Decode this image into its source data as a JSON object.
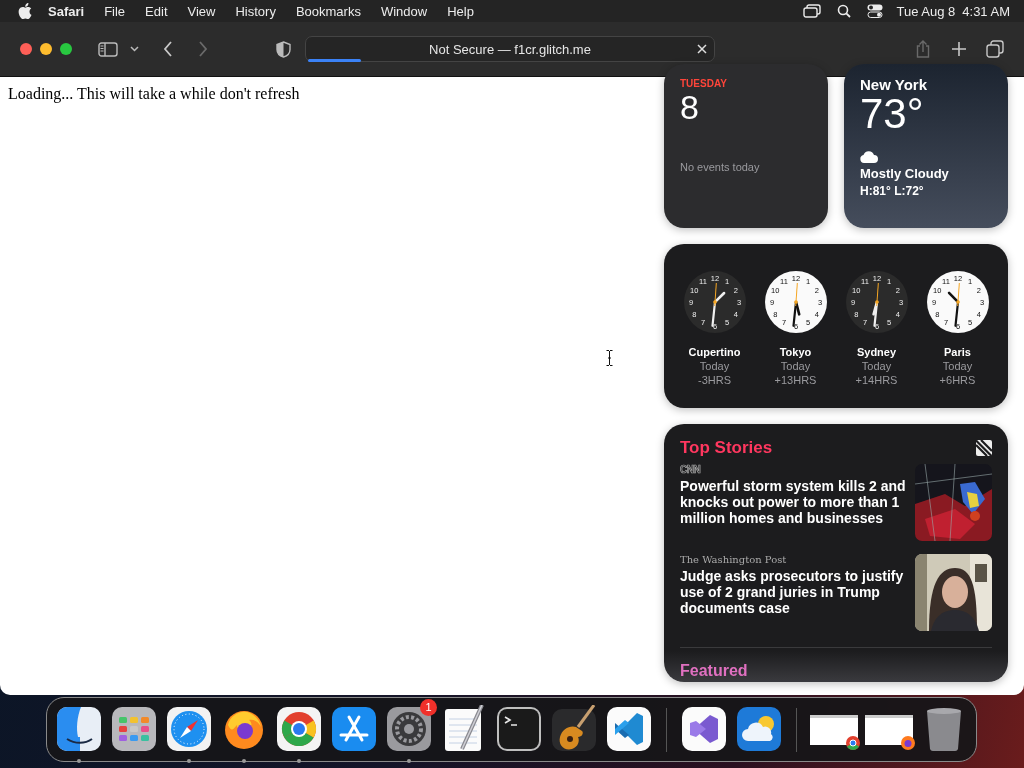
{
  "menu_bar": {
    "menus": [
      {
        "label": "Safari",
        "kind": "app"
      },
      {
        "label": "File",
        "kind": "menu"
      },
      {
        "label": "Edit",
        "kind": "menu"
      },
      {
        "label": "View",
        "kind": "menu"
      },
      {
        "label": "History",
        "kind": "menu"
      },
      {
        "label": "Bookmarks",
        "kind": "menu"
      },
      {
        "label": "Window",
        "kind": "menu"
      },
      {
        "label": "Help",
        "kind": "menu"
      }
    ],
    "date": "Tue Aug 8",
    "time": "4:31 AM"
  },
  "browser": {
    "address": "Not Secure — f1cr.glitch.me",
    "progress": {
      "level": 0.13
    },
    "back_disabled": false,
    "forward_disabled": true,
    "share_disabled": true
  },
  "page": {
    "text": "Loading... This will take a while don't refresh"
  },
  "widgets": {
    "calendar": {
      "weekday": "TUESDAY",
      "day": "8",
      "events": "No events today"
    },
    "weather": {
      "city": "New York",
      "temperature": "73°",
      "condition": "Mostly Cloudy",
      "range": "H:81° L:72°"
    },
    "world_clock": {
      "clocks": [
        {
          "city": "Cupertino",
          "day": "Today",
          "offset": "-3HRS",
          "dark": true,
          "numerals": [
            "11",
            "12",
            "1",
            "10",
            "2",
            "9",
            "3",
            "8",
            "4",
            "7",
            "6",
            "5"
          ]
        },
        {
          "city": "Tokyo",
          "day": "Today",
          "offset": "+13HRS",
          "dark": false,
          "numerals": [
            "11",
            "12",
            "1",
            "10",
            "2",
            "9",
            "3",
            "8",
            "4",
            "7",
            "6",
            "5"
          ]
        },
        {
          "city": "Sydney",
          "day": "Today",
          "offset": "+14HRS",
          "dark": true,
          "numerals": [
            "11",
            "12",
            "1",
            "10",
            "2",
            "9",
            "3",
            "8",
            "4",
            "7",
            "6",
            "5"
          ]
        },
        {
          "city": "Paris",
          "day": "Today",
          "offset": "+6HRS",
          "dark": false,
          "numerals": [
            "11",
            "12",
            "1",
            "10",
            "2",
            "9",
            "3",
            "8",
            "4",
            "7",
            "6",
            "5"
          ]
        }
      ]
    },
    "news": {
      "title": "Top Stories",
      "stories": [
        {
          "source": {
            "text": "CNN",
            "kind": "outline"
          },
          "headline": "Powerful storm system kills 2 and knocks out power to more than 1 million homes and businesses"
        },
        {
          "source": {
            "text": "The Washington Post",
            "kind": "blackletter"
          },
          "headline": "Judge asks prosecutors to justify use of 2 grand juries in Trump documents case"
        }
      ],
      "next_section": "Featured"
    }
  },
  "dock": {
    "items": [
      {
        "kind": "finder",
        "running": true
      },
      {
        "kind": "launchpad",
        "running": false
      },
      {
        "kind": "safari",
        "running": true
      },
      {
        "kind": "firefox",
        "running": true
      },
      {
        "kind": "chrome",
        "running": true
      },
      {
        "kind": "appstore",
        "running": false
      },
      {
        "kind": "settings",
        "running": true,
        "badge": "1"
      },
      {
        "kind": "textedit",
        "running": false
      },
      {
        "kind": "terminal",
        "running": false
      },
      {
        "kind": "guitar",
        "running": false
      },
      {
        "kind": "vscode",
        "running": false
      },
      {
        "kind": "divider"
      },
      {
        "kind": "visualstudio",
        "running": false
      },
      {
        "kind": "weather",
        "running": false
      },
      {
        "kind": "divider"
      },
      {
        "kind": "window",
        "badge": {
          "kind": "chrome"
        }
      },
      {
        "kind": "window",
        "badge": {
          "kind": "firefox"
        }
      },
      {
        "kind": "trash"
      }
    ]
  }
}
